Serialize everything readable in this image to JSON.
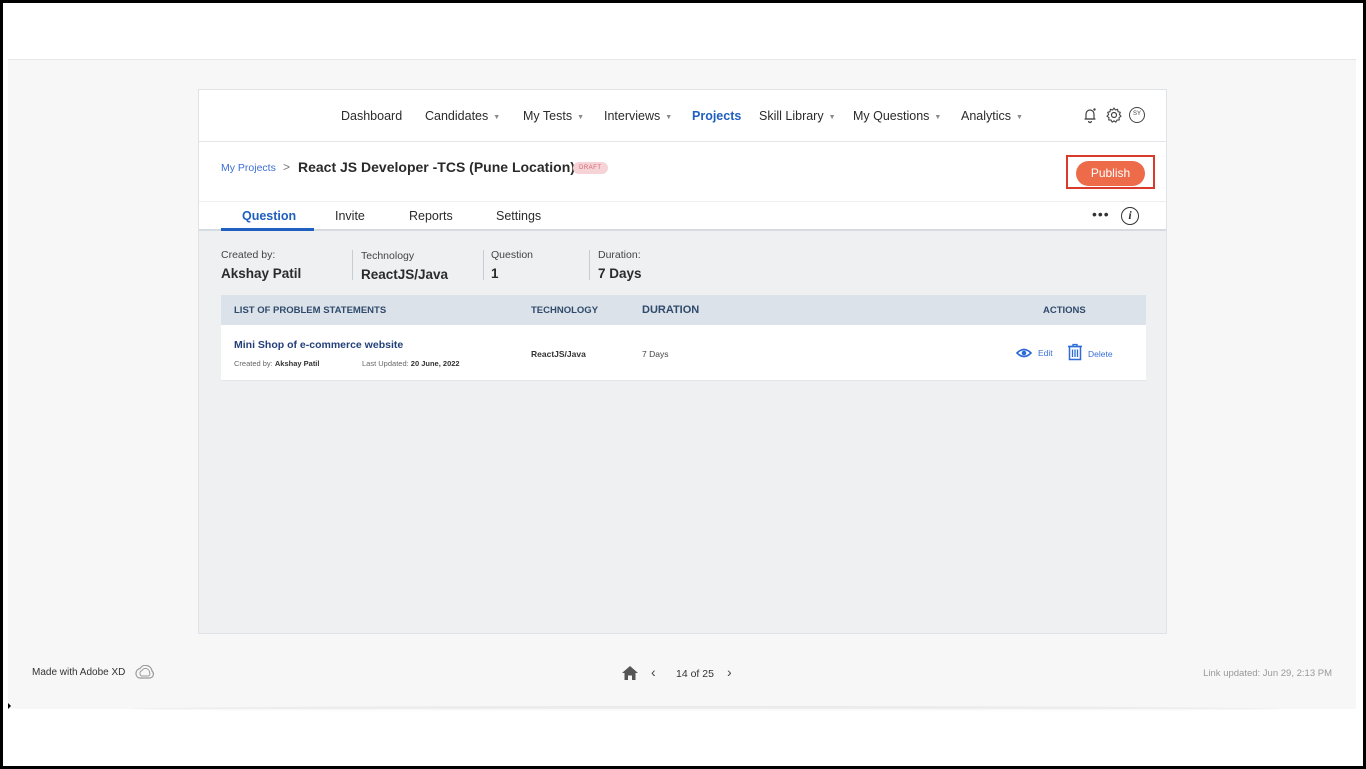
{
  "nav": {
    "items": [
      {
        "label": "Dashboard",
        "dropdown": false
      },
      {
        "label": "Candidates",
        "dropdown": true
      },
      {
        "label": "My Tests",
        "dropdown": true
      },
      {
        "label": "Interviews",
        "dropdown": true
      },
      {
        "label": "Projects",
        "dropdown": false,
        "active": true
      },
      {
        "label": "Skill Library",
        "dropdown": true
      },
      {
        "label": "My Questions",
        "dropdown": true
      },
      {
        "label": "Analytics",
        "dropdown": true
      }
    ],
    "caret": "▼",
    "icons": [
      "bell-icon",
      "gear-icon",
      "avatar"
    ],
    "avatar_initials": "SY"
  },
  "header": {
    "breadcrumb_link": "My Projects",
    "breadcrumb_sep": ">",
    "title": "React JS  Developer -TCS (Pune Location)",
    "badge": "DRAFT",
    "publish_label": "Publish",
    "highlight_color": "#d93a2b",
    "accent_color": "#ee6b4a"
  },
  "tabs": {
    "items": [
      "Question",
      "Invite",
      "Reports",
      "Settings"
    ],
    "active": "Question",
    "more": "•••",
    "info": "i"
  },
  "meta": {
    "created_by_label": "Created by:",
    "created_by_value": "Akshay Patil",
    "technology_label": "Technology",
    "technology_value": "ReactJS/Java",
    "question_label": "Question",
    "question_value": "1",
    "duration_label": "Duration:",
    "duration_value": "7 Days"
  },
  "table": {
    "headers": {
      "problem": "LIST OF PROBLEM STATEMENTS",
      "technology": "TECHNOLOGY",
      "duration": "DURATION",
      "actions": "ACTIONS"
    },
    "rows": [
      {
        "title": "Mini Shop of e-commerce website",
        "created_by_label": "Created by:",
        "created_by": "Akshay Patil",
        "updated_label": "Last Updated:",
        "updated": "20 June, 2022",
        "technology": "ReactJS/Java",
        "duration": "7 Days",
        "edit_label": "Edit",
        "delete_label": "Delete"
      }
    ]
  },
  "xd": {
    "made_with": "Made with Adobe XD",
    "page_indicator": "14 of 25",
    "prev": "‹",
    "next": "›",
    "link_updated": "Link updated: Jun 29, 2:13 PM"
  }
}
